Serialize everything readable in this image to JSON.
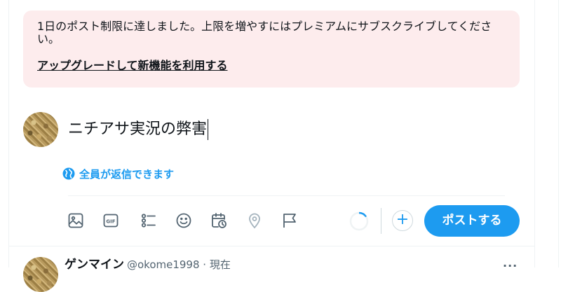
{
  "limit_banner": {
    "message": "1日のポスト制限に達しました。上限を増やすにはプレミアムにサブスクライブしてください。",
    "upgrade_link": "アップグレードして新機能を利用する"
  },
  "compose": {
    "text": "ニチアサ実況の弊害",
    "reply_setting": "全員が返信できます",
    "toolbar_icons": [
      "image-icon",
      "gif-icon",
      "poll-icon",
      "emoji-icon",
      "schedule-icon",
      "location-icon",
      "flag-icon"
    ],
    "post_button": "ポストする",
    "add_label": "+"
  },
  "feed_item": {
    "author_name": "ゲンマイン",
    "handle_time": "@okome1998 · 現在",
    "more_label": "···"
  },
  "colors": {
    "accent": "#1d9bf0",
    "banner_bg": "#fdeced",
    "icon_gray": "#536471"
  }
}
